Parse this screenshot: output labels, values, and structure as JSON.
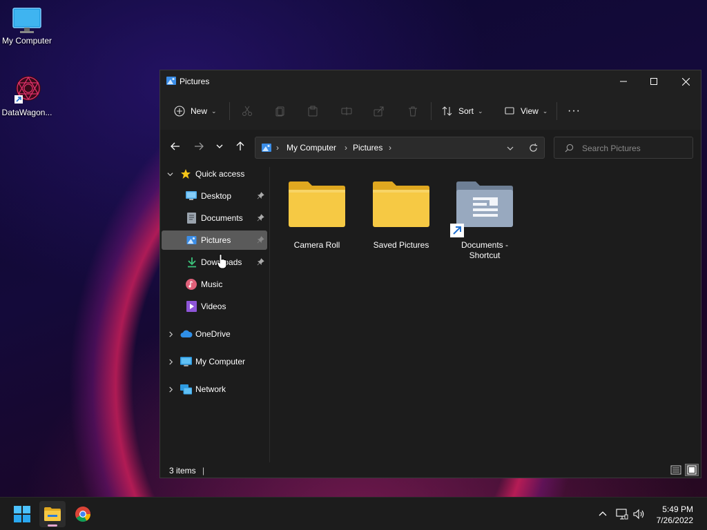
{
  "desktop": {
    "icons": [
      {
        "label": "My Computer"
      },
      {
        "label": "DataWagon..."
      }
    ]
  },
  "window": {
    "title": "Pictures",
    "toolbar": {
      "new_label": "New",
      "sort_label": "Sort",
      "view_label": "View",
      "more_label": "···"
    },
    "address": {
      "crumbs": [
        "My Computer",
        "Pictures"
      ]
    },
    "search": {
      "placeholder": "Search Pictures"
    },
    "nav": {
      "quick_access": "Quick access",
      "items": [
        {
          "label": "Desktop",
          "pinned": true
        },
        {
          "label": "Documents",
          "pinned": true
        },
        {
          "label": "Pictures",
          "pinned": true,
          "selected": true
        },
        {
          "label": "Downloads",
          "pinned": true
        },
        {
          "label": "Music",
          "pinned": false
        },
        {
          "label": "Videos",
          "pinned": false
        }
      ],
      "roots": [
        {
          "label": "OneDrive"
        },
        {
          "label": "My Computer"
        },
        {
          "label": "Network"
        }
      ]
    },
    "files": [
      {
        "line1": "Camera Roll",
        "line2": ""
      },
      {
        "line1": "Saved Pictures",
        "line2": ""
      },
      {
        "line1": "Documents -",
        "line2": "Shortcut"
      }
    ],
    "status": {
      "count": "3 items"
    }
  },
  "taskbar": {
    "time": "5:49 PM",
    "date": "7/26/2022"
  },
  "colors": {
    "folder": "#f6c944",
    "accent": "#3b8ee8",
    "selected": "#5a5a5a"
  }
}
